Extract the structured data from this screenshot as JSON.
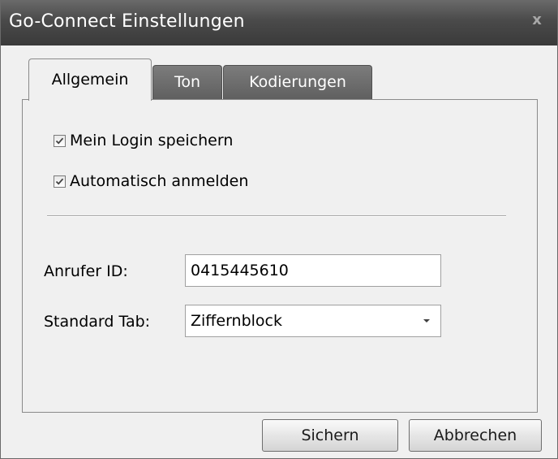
{
  "window": {
    "title": "Go-Connect Einstellungen",
    "close_label": "x"
  },
  "tabs": [
    {
      "label": "Allgemein",
      "active": true
    },
    {
      "label": "Ton",
      "active": false
    },
    {
      "label": "Kodierungen",
      "active": false
    }
  ],
  "general": {
    "save_login": {
      "label": "Mein Login speichern",
      "checked": true
    },
    "auto_login": {
      "label": "Automatisch anmelden",
      "checked": true
    },
    "caller_id": {
      "label": "Anrufer ID:",
      "value": "0415445610"
    },
    "default_tab": {
      "label": "Standard Tab:",
      "value": "Ziffernblock"
    }
  },
  "buttons": {
    "save": "Sichern",
    "cancel": "Abbrechen"
  },
  "icons": {
    "close": "close-icon",
    "checkmark": "check-icon",
    "dropdown": "chevron-down-icon"
  },
  "colors": {
    "titlebar": "#4a4a4a",
    "inactive_tab": "#6a6a6a",
    "panel_bg": "#f0f0f0"
  }
}
